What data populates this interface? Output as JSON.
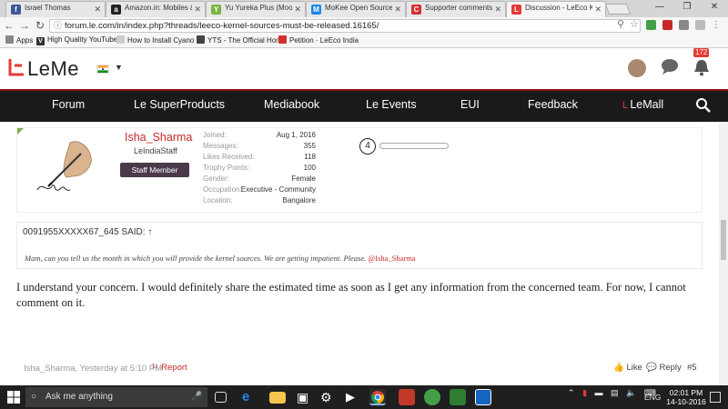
{
  "browser": {
    "tabs": [
      {
        "title": "Israel Thomas",
        "color": "#3b5998",
        "glyph": "f"
      },
      {
        "title": "Amazon.in: Mobiles & A",
        "color": "#222",
        "glyph": "a"
      },
      {
        "title": "Yu Yureka Plus (Moon D",
        "color": "#7cb342",
        "glyph": "Y"
      },
      {
        "title": "MoKee Open Source D",
        "color": "#1e88e5",
        "glyph": "M"
      },
      {
        "title": "Supporter comments | L",
        "color": "#d32f2f",
        "glyph": "C"
      },
      {
        "title": "Discussion - LeEco Kern",
        "color": "#e53935",
        "glyph": "L"
      }
    ],
    "url": "forum.le.com/in/index.php?threads/leeco-kernel-sources-must-be-released.16165/",
    "bookmarks": [
      {
        "label": "Apps",
        "color": "#888",
        "glyph": ""
      },
      {
        "label": "High Quality YouTube",
        "color": "#333",
        "glyph": "V"
      },
      {
        "label": "How to Install Cyano",
        "color": "#bbb",
        "glyph": ""
      },
      {
        "label": "YTS - The Official Hom",
        "color": "#444",
        "glyph": ""
      },
      {
        "label": "Petition · LeEco India",
        "color": "#d32f2f",
        "glyph": ""
      }
    ]
  },
  "site": {
    "logo_text": "LeMe",
    "notif_count": "172",
    "nav": [
      "Forum",
      "Le SuperProducts",
      "Mediabook",
      "Le Events",
      "EUI",
      "Feedback",
      "LeMall"
    ]
  },
  "profile": {
    "username": "Isha_Sharma",
    "title": "LeIndiaStaff",
    "badge": "Staff Member",
    "stats": [
      {
        "label": "Joined:",
        "value": "Aug 1, 2016"
      },
      {
        "label": "Messages:",
        "value": "355"
      },
      {
        "label": "Likes Received:",
        "value": "118"
      },
      {
        "label": "Trophy Points:",
        "value": "100"
      },
      {
        "label": "Gender:",
        "value": "Female"
      },
      {
        "label": "Occupation:",
        "value": "Executive - Community"
      },
      {
        "label": "Location:",
        "value": "Bangalore"
      }
    ],
    "message_number": "4"
  },
  "quote": {
    "header": "0091955XXXXX67_645 SAID: ↑",
    "text": "Mam, can you tell us the month in which you will provide the kernel sources. We are getting impatient. Please.",
    "mention": "@Isha_Sharma"
  },
  "post": {
    "body": "I understand your concern. I would definitely share the estimated time as soon as I get any information from the concerned team. For now, I cannot comment on it.",
    "meta": "Isha_Sharma, Yesterday at 5:10 PM",
    "report": "Report",
    "like": "Like",
    "reply": "Reply",
    "number": "#5"
  },
  "taskbar": {
    "search_placeholder": "Ask me anything",
    "lang": "ENG",
    "time": "02:01 PM",
    "date": "14-10-2016"
  }
}
